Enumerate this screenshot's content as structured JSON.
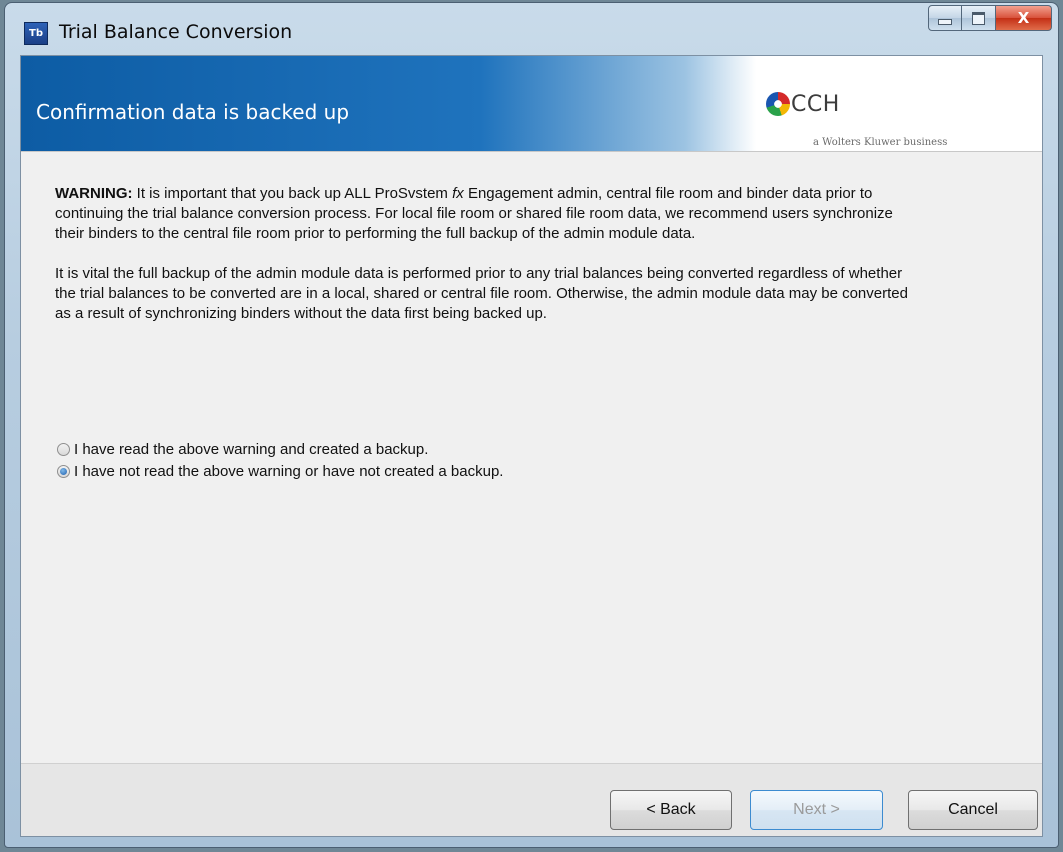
{
  "window": {
    "title": "Trial Balance Conversion",
    "app_icon_text": "Tb",
    "controls": {
      "minimize": "minimize",
      "maximize": "maximize",
      "close": "X"
    }
  },
  "header": {
    "page_title": "Confirmation data is backed up",
    "logo_text": "CCH",
    "logo_sub": "a Wolters Kluwer business"
  },
  "body": {
    "warning_label": "WARNING:",
    "warning_pre": " It is important that you back up ALL ProSvstem ",
    "warning_fx": "fx",
    "warning_post": " Engagement admin, central file room and binder data prior to continuing the trial balance conversion process.  For local file room or shared file room data, we recommend users synchronize their binders to the central file room prior to performing the full backup of the admin module data.",
    "paragraph2": "It is vital the full backup of the admin module data is performed prior to any trial balances being converted regardless of whether the trial balances to be converted are in a local, shared or central file room.  Otherwise, the admin module data may be converted as a result of synchronizing binders without the data first being backed up."
  },
  "options": [
    {
      "label": "I have read the above warning and created a backup.",
      "selected": false
    },
    {
      "label": "I have not read the above warning or have not created a backup.",
      "selected": true
    }
  ],
  "footer": {
    "back_label": "< Back",
    "next_label": "Next >",
    "cancel_label": "Cancel"
  }
}
